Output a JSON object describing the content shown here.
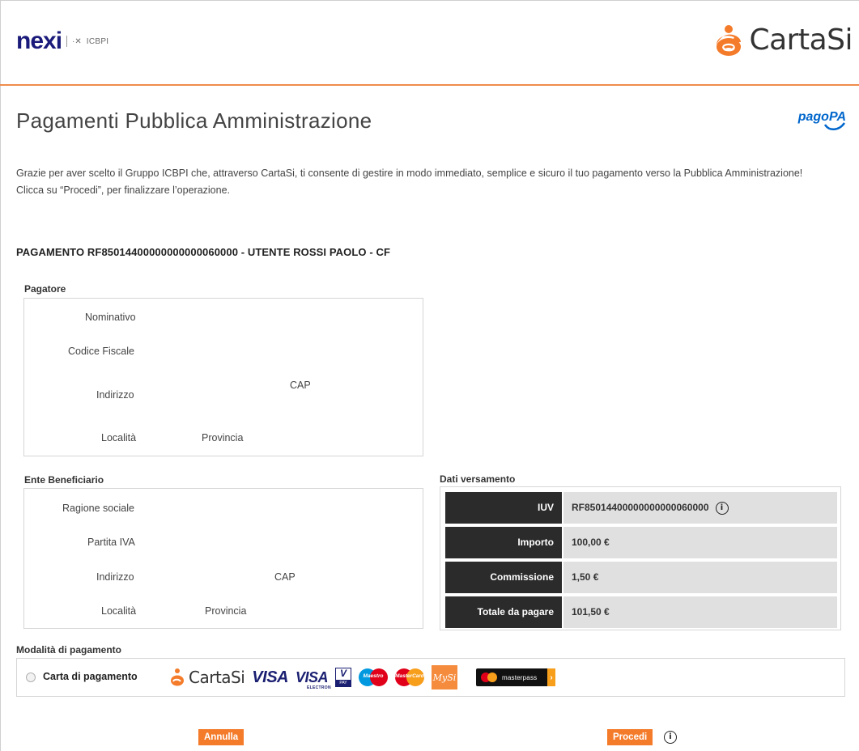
{
  "header": {
    "nexi_logo": "nexi",
    "nexi_sub": "ICBPI",
    "cartasi_logo": "CartaSi"
  },
  "page": {
    "title": "Pagamenti Pubblica Amministrazione",
    "pagopa_logo": "pagoPA",
    "intro_line1": "Grazie per aver scelto il Gruppo ICBPI che, attraverso CartaSi, ti consente di gestire in modo immediato, semplice e sicuro il tuo pagamento verso la Pubblica Amministrazione!",
    "intro_line2": "Clicca su “Procedi”, per finalizzare l’operazione.",
    "payment_header": "PAGAMENTO RF85014400000000000060000 - UTENTE ROSSI PAOLO - CF"
  },
  "pagatore": {
    "section_label": "Pagatore",
    "nominativo": "Nominativo",
    "codice_fiscale": "Codice Fiscale",
    "indirizzo": "Indirizzo",
    "cap": "CAP",
    "localita": "Località",
    "provincia": "Provincia"
  },
  "ente": {
    "section_label": "Ente Beneficiario",
    "ragione_sociale": "Ragione sociale",
    "partita_iva": "Partita IVA",
    "indirizzo": "Indirizzo",
    "cap": "CAP",
    "localita": "Località",
    "provincia": "Provincia"
  },
  "versamento": {
    "section_label": "Dati versamento",
    "rows": [
      {
        "key": "IUV",
        "value": "RF85014400000000000060000"
      },
      {
        "key": "Importo",
        "value": "100,00 €"
      },
      {
        "key": "Commissione",
        "value": "1,50 €"
      },
      {
        "key": "Totale da pagare",
        "value": "101,50 €"
      }
    ],
    "info_glyph": "i"
  },
  "modalita": {
    "section_label": "Modalità di pagamento",
    "option_label": "Carta di pagamento",
    "brands": {
      "cartasi": "CartaSi",
      "visa": "VISA",
      "visa_electron": "VISA",
      "visa_electron_sub": "ELECTRON",
      "vpay_letter": "V",
      "vpay_sub": "PAY",
      "maestro": "Maestro",
      "mastercard": "MasterCard",
      "mysi": "MySi",
      "masterpass": "masterpass"
    }
  },
  "actions": {
    "cancel_label": "Annulla",
    "proceed_label": "Procedi",
    "info_glyph": "i"
  },
  "colors": {
    "accent": "#f47b2a",
    "dark_cell": "#2b2b2b",
    "light_cell": "#e0e0e0",
    "nexi_blue": "#1a1a7a",
    "pagopa_blue": "#0066cc"
  }
}
